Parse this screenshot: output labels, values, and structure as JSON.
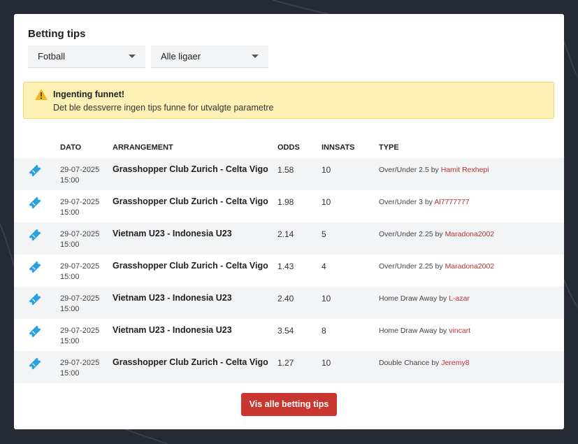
{
  "page_title": "Betting tips",
  "filters": {
    "sport": "Fotball",
    "league": "Alle ligaer"
  },
  "alert": {
    "title": "Ingenting funnet!",
    "message": "Det ble dessverre ingen tips funne for utvalgte parametre"
  },
  "table": {
    "headers": {
      "date": "DATO",
      "event": "ARRANGEMENT",
      "odds": "ODDS",
      "stake": "INNSATS",
      "type": "TYPE"
    },
    "rows": [
      {
        "date": "29-07-2025",
        "time": "15:00",
        "event": "Grasshopper Club Zurich - Celta Vigo",
        "odds": "1.58",
        "stake": "10",
        "type": "Over/Under 2.5",
        "by": "by",
        "user": "Hamit Rexhepi"
      },
      {
        "date": "29-07-2025",
        "time": "15:00",
        "event": "Grasshopper Club Zurich - Celta Vigo",
        "odds": "1.98",
        "stake": "10",
        "type": "Over/Under 3",
        "by": "by",
        "user": "Al7777777"
      },
      {
        "date": "29-07-2025",
        "time": "15:00",
        "event": "Vietnam U23 - Indonesia U23",
        "odds": "2.14",
        "stake": "5",
        "type": "Over/Under 2.25",
        "by": "by",
        "user": "Maradona2002"
      },
      {
        "date": "29-07-2025",
        "time": "15:00",
        "event": "Grasshopper Club Zurich - Celta Vigo",
        "odds": "1.43",
        "stake": "4",
        "type": "Over/Under 2.25",
        "by": "by",
        "user": "Maradona2002"
      },
      {
        "date": "29-07-2025",
        "time": "15:00",
        "event": "Vietnam U23 - Indonesia U23",
        "odds": "2.40",
        "stake": "10",
        "type": "Home Draw Away",
        "by": "by",
        "user": "L-azar"
      },
      {
        "date": "29-07-2025",
        "time": "15:00",
        "event": "Vietnam U23 - Indonesia U23",
        "odds": "3.54",
        "stake": "8",
        "type": "Home Draw Away",
        "by": "by",
        "user": "vincart"
      },
      {
        "date": "29-07-2025",
        "time": "15:00",
        "event": "Grasshopper Club Zurich - Celta Vigo",
        "odds": "1.27",
        "stake": "10",
        "type": "Double Chance",
        "by": "by",
        "user": "Jeremy8"
      }
    ]
  },
  "cta_label": "Vis alle betting tips",
  "icons": {
    "ticket": "ticket-icon",
    "warning": "warning-icon",
    "dropdown": "chevron-down-icon"
  },
  "colors": {
    "accent": "#c8372f",
    "ticket_blue": "#2aa0dc",
    "alert_bg": "#fdf1b5",
    "alert_icon": "#f1b81f",
    "username": "#b5322e"
  }
}
